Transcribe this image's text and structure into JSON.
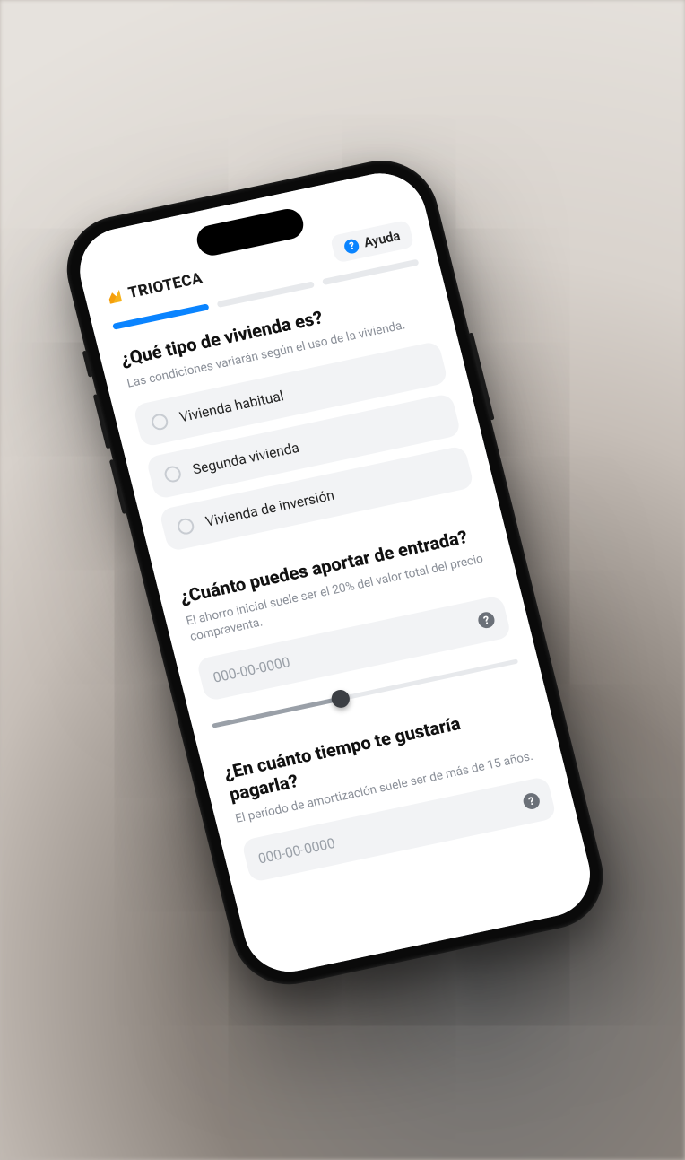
{
  "header": {
    "brand": "TRIOTECA",
    "help_label": "Ayuda"
  },
  "progress": {
    "segments": 3,
    "active_index": 0
  },
  "q1": {
    "title": "¿Qué tipo de vivienda es?",
    "subtitle": "Las condiciones variarán según el uso de la vivienda.",
    "options": [
      "Vivienda habitual",
      "Segunda vivienda",
      "Vivienda de inversión"
    ]
  },
  "q2": {
    "title": "¿Cuánto puedes aportar de entrada?",
    "subtitle": "El ahorro inicial suele ser el 20% del valor total del precio compraventa.",
    "placeholder": "000-00-0000",
    "slider_percent": 42
  },
  "q3": {
    "title": "¿En cuánto tiempo te gustaría pagarla?",
    "subtitle": "El período de amortización suele ser de más de 15 años.",
    "placeholder": "000-00-0000"
  }
}
